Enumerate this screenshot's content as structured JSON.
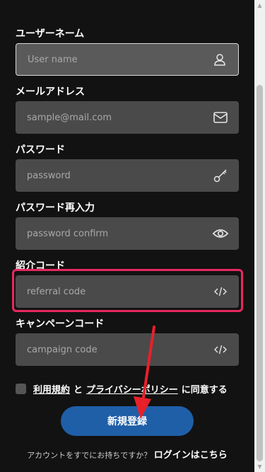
{
  "fields": {
    "username": {
      "label": "ユーザーネーム",
      "placeholder": "User name",
      "icon": "user-icon"
    },
    "email": {
      "label": "メールアドレス",
      "placeholder": "sample@mail.com",
      "icon": "mail-icon"
    },
    "password": {
      "label": "パスワード",
      "placeholder": "password",
      "icon": "key-icon"
    },
    "password_confirm": {
      "label": "パスワード再入力",
      "placeholder": "password confirm",
      "icon": "eye-icon"
    },
    "referral": {
      "label": "紹介コード",
      "placeholder": "referral code",
      "icon": "code-icon"
    },
    "campaign": {
      "label": "キャンペーンコード",
      "placeholder": "campaign code",
      "icon": "code-icon"
    }
  },
  "agreement": {
    "terms_link": "利用規約",
    "conjunction": "と",
    "privacy_link": "プライバシーポリシー",
    "suffix": "に同意する"
  },
  "submit_label": "新規登録",
  "login": {
    "question": "アカウントをすでにお持ちですか？",
    "link": "ログインはこちら"
  },
  "colors": {
    "background": "#121212",
    "input": "#4a4a4a",
    "button": "#1f5fa8",
    "highlight": "#e8285f",
    "arrow": "#e8202a"
  }
}
